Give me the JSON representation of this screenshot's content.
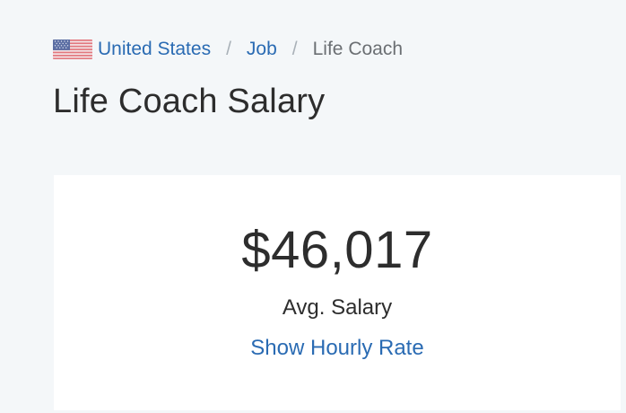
{
  "breadcrumb": {
    "country": "United States",
    "separator": "/",
    "category": "Job",
    "current": "Life Coach"
  },
  "header": {
    "title": "Life Coach Salary"
  },
  "salary_card": {
    "amount": "$46,017",
    "label": "Avg. Salary",
    "toggle_link": "Show Hourly Rate"
  },
  "icons": {
    "flag": "us-flag-icon"
  },
  "colors": {
    "link": "#2a6bb3",
    "background": "#f4f7f9",
    "card": "#ffffff",
    "text": "#2d2d2d"
  }
}
